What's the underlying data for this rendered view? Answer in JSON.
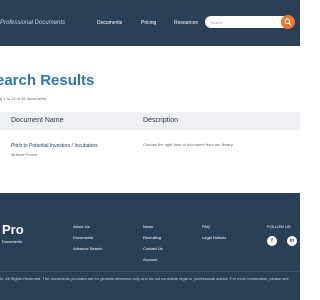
{
  "header": {
    "tagline": "Professional Documents",
    "nav": [
      "Documents",
      "Pricing",
      "Resources"
    ],
    "search": {
      "placeholder": "Search"
    }
  },
  "main": {
    "title": "earch Results",
    "count": "g 1 to 12 of 16 documents",
    "table": {
      "columns": [
        "Document Name",
        "Description"
      ],
      "rows": [
        {
          "name": "Pitch to Potential Investors / Incubators",
          "sub": "Multiple Forms",
          "description": "Choose the right form of document from our library."
        }
      ]
    }
  },
  "footer": {
    "logo_big": "Pro",
    "logo_small": "Documents",
    "col1": [
      "About Us",
      "Documents",
      "Advance Search"
    ],
    "col2": [
      "News",
      "Recruiting",
      "Contact Us",
      "Account"
    ],
    "col3": [
      "FAQ",
      "Legal Notices"
    ],
    "follow": "FOLLOW US",
    "social": [
      "f",
      "in"
    ],
    "copyright": "ts. All Rights Reserved. The documents provided are for general reference only and do not constitute legal or professional advice. For more information, please see"
  },
  "colors": {
    "navy": "#2b3f55",
    "accent_orange": "#e8792f",
    "title_blue": "#2e77b5"
  }
}
